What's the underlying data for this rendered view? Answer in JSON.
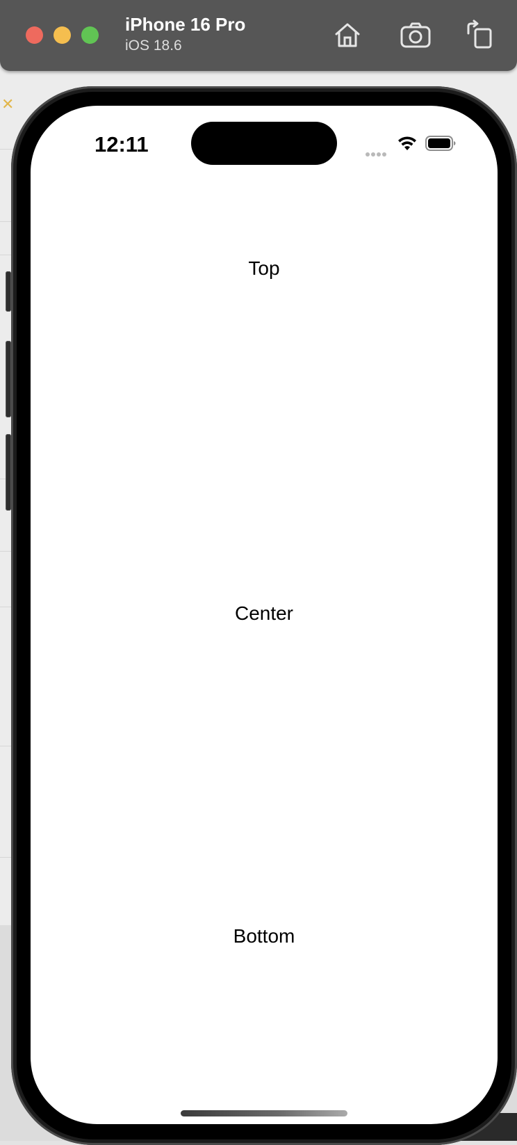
{
  "simulator": {
    "device_name": "iPhone 16 Pro",
    "os_version": "iOS 18.6",
    "toolbar": {
      "home_icon": "home-icon",
      "screenshot_icon": "camera-icon",
      "rotate_icon": "rotate-icon"
    },
    "traffic_lights": {
      "close_color": "#ee6a5e",
      "minimize_color": "#f5be4f",
      "zoom_color": "#61c454"
    }
  },
  "status_bar": {
    "time": "12:11",
    "icons": [
      "cellular-signal-icon",
      "wifi-icon",
      "battery-icon"
    ]
  },
  "screen": {
    "top_label": "Top",
    "center_label": "Center",
    "bottom_label": "Bottom",
    "background": "#ffffff"
  }
}
